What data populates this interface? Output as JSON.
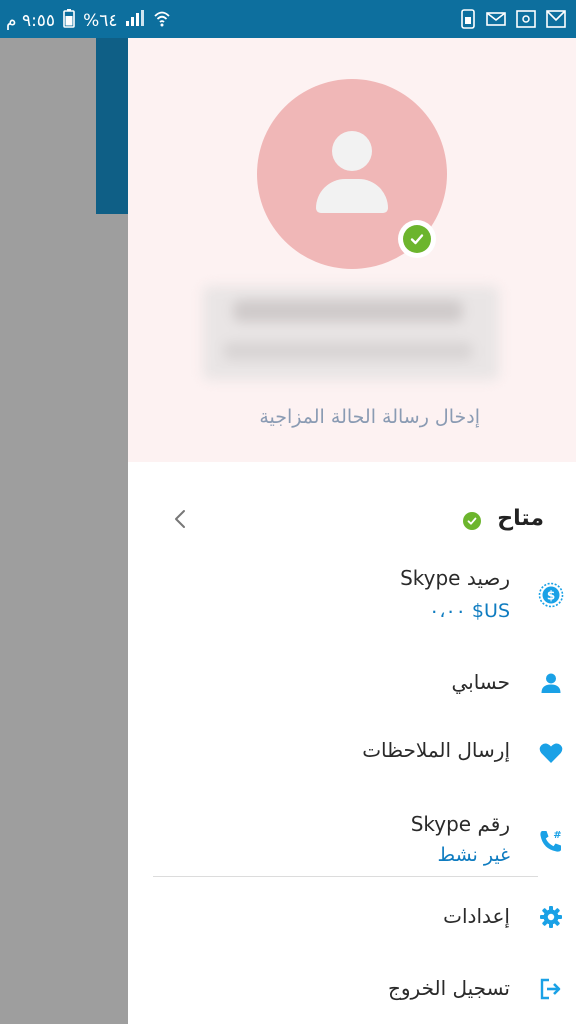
{
  "status_bar": {
    "time": "٩:٥٥ م",
    "battery": "%٦٤"
  },
  "drawer": {
    "mood_placeholder": "إدخال رسالة الحالة المزاجية",
    "status": "متاح",
    "menu": {
      "credit_label": "رصيد Skype",
      "credit_value": "US$ ٠،٠٠",
      "account_label": "حسابي",
      "feedback_label": "إرسال الملاحظات",
      "number_label": "رقم Skype",
      "number_value": "غير نشط",
      "settings_label": "إعدادات",
      "signout_label": "تسجيل الخروج"
    }
  },
  "colors": {
    "accent": "#0f7cc0",
    "presence": "#6cb52d",
    "icon": "#1aa1e6"
  },
  "icons": [
    "dollar-circle-icon",
    "person-icon",
    "heart-icon",
    "phone-hash-icon",
    "gear-icon",
    "sign-out-icon",
    "chevron-left-icon",
    "check-icon"
  ]
}
